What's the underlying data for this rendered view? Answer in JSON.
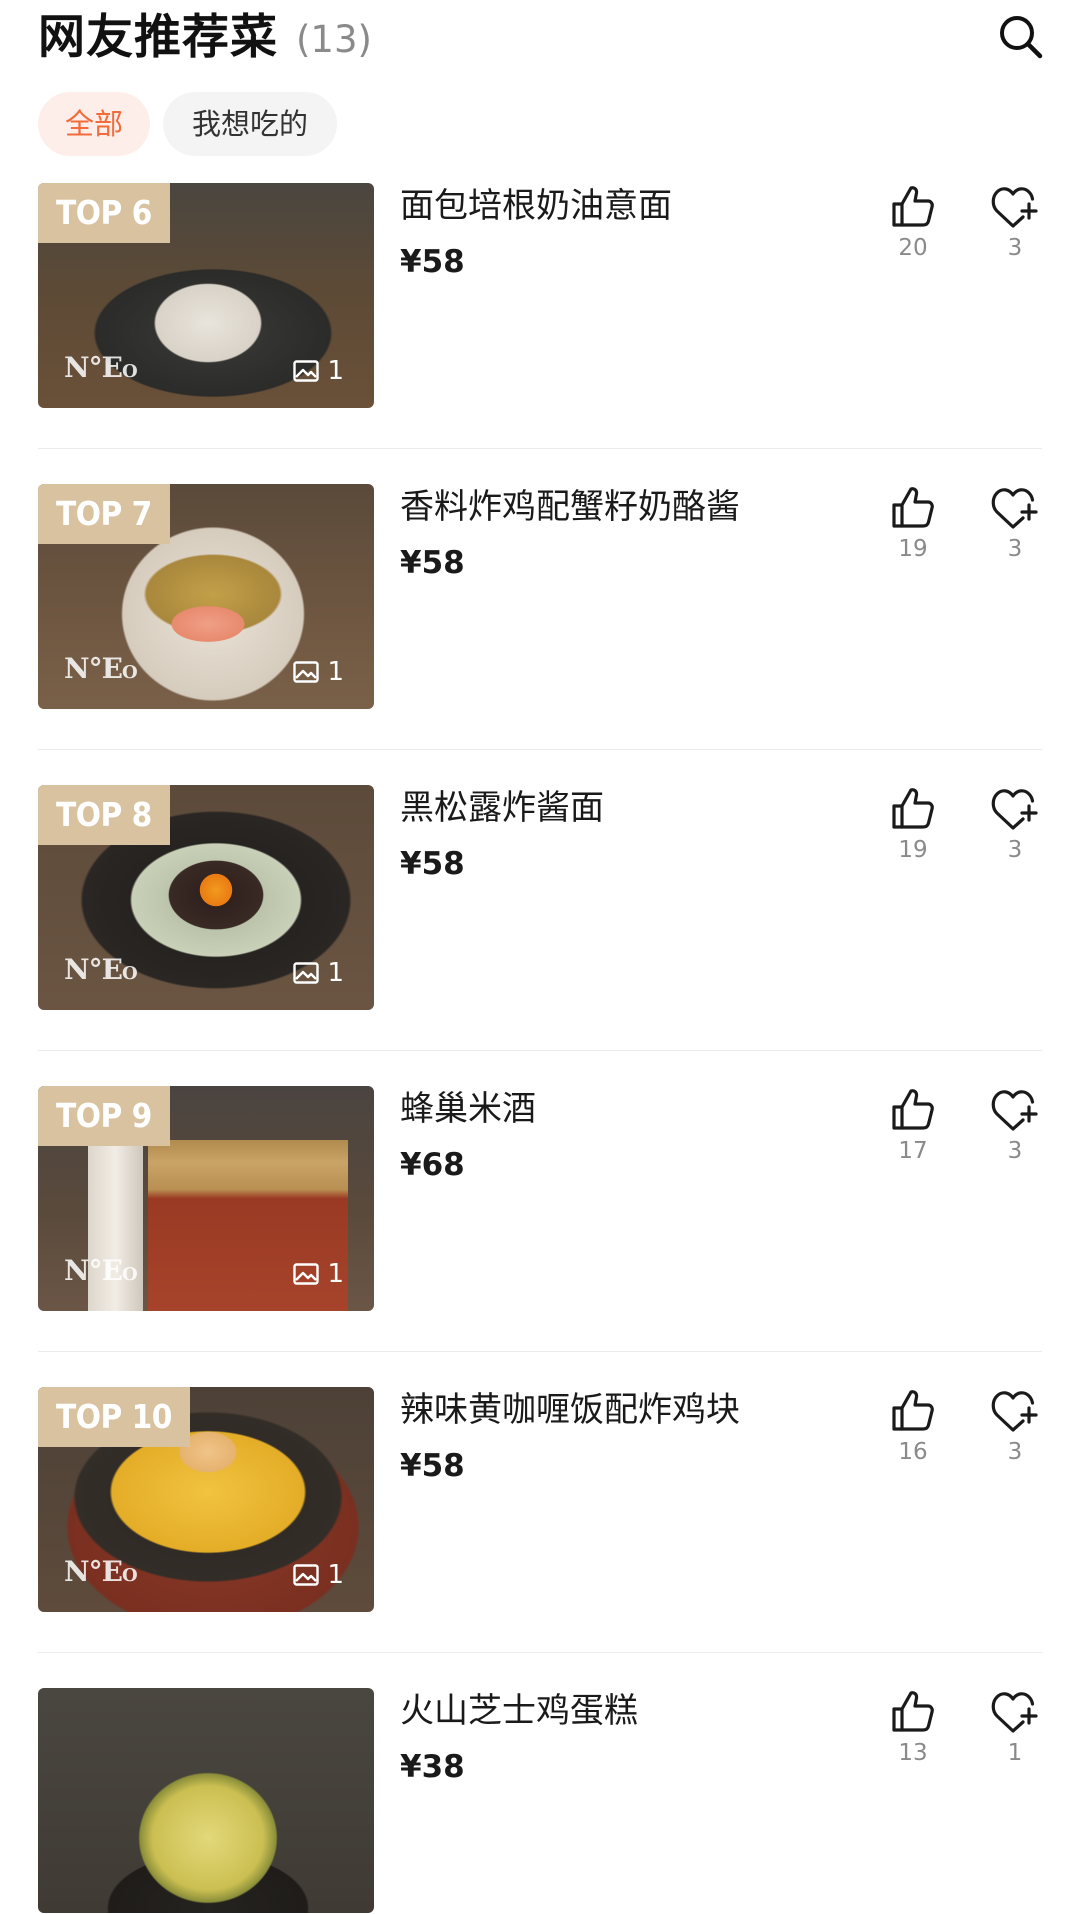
{
  "header": {
    "title": "网友推荐菜",
    "count": "(13)"
  },
  "filters": [
    {
      "label": "全部",
      "active": true
    },
    {
      "label": "我想吃的",
      "active": false
    }
  ],
  "dishes": [
    {
      "rank": "TOP 6",
      "name": "面包培根奶油意面",
      "price": "¥58",
      "likes": "20",
      "favorites": "3",
      "photos": "1"
    },
    {
      "rank": "TOP 7",
      "name": "香料炸鸡配蟹籽奶酪酱",
      "price": "¥58",
      "likes": "19",
      "favorites": "3",
      "photos": "1"
    },
    {
      "rank": "TOP 8",
      "name": "黑松露炸酱面",
      "price": "¥58",
      "likes": "19",
      "favorites": "3",
      "photos": "1"
    },
    {
      "rank": "TOP 9",
      "name": "蜂巢米酒",
      "price": "¥68",
      "likes": "17",
      "favorites": "3",
      "photos": "1"
    },
    {
      "rank": "TOP 10",
      "name": "辣味黄咖喱饭配炸鸡块",
      "price": "¥58",
      "likes": "16",
      "favorites": "3",
      "photos": "1"
    },
    {
      "rank": "",
      "name": "火山芝士鸡蛋糕",
      "price": "¥38",
      "likes": "13",
      "favorites": "1",
      "photos": ""
    }
  ],
  "icons": {
    "search": "search-icon",
    "like": "thumbs-up-icon",
    "favorite": "heart-plus-icon",
    "photo": "image-icon"
  },
  "colors": {
    "accent": "#f26b3a",
    "accent_bg": "#fdeeea",
    "rank_badge": "#d8c2a0",
    "muted_text": "#8a8a8a"
  }
}
